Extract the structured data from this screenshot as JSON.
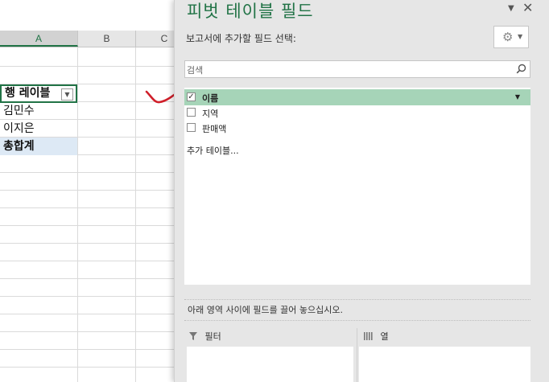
{
  "sheet": {
    "columns": [
      "A",
      "B",
      "C"
    ],
    "pivot": {
      "header": "행 레이블",
      "rows": [
        "김민수",
        "이지은"
      ],
      "total": "총합계"
    }
  },
  "pane": {
    "title": "피벗 테이블 필드",
    "choose_label": "보고서에 추가할 필드 선택:",
    "search_placeholder": "검색",
    "fields": [
      {
        "label": "이름",
        "checked": true
      },
      {
        "label": "지역",
        "checked": false
      },
      {
        "label": "판매액",
        "checked": false
      }
    ],
    "more_tables": "추가 테이블...",
    "drag_hint": "아래 영역 사이에 필드를 끌어 놓으십시오.",
    "areas": {
      "filter_label": "필터",
      "columns_label": "열"
    }
  },
  "colors": {
    "accent": "#217346",
    "selected_field": "#a6d4b8",
    "annotation_mark": "#d01f2a"
  }
}
